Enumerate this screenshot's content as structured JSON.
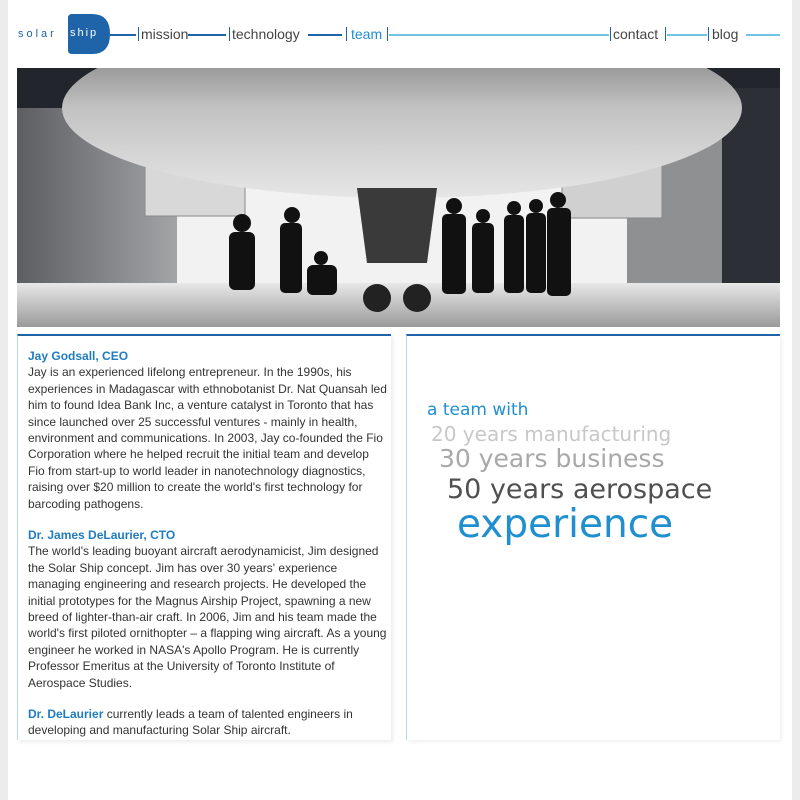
{
  "logo": {
    "solar": "solar",
    "ship": "ship"
  },
  "nav": {
    "items": [
      {
        "label": "mission",
        "active": false
      },
      {
        "label": "technology",
        "active": false
      },
      {
        "label": "team",
        "active": true
      },
      {
        "label": "contact",
        "active": false
      },
      {
        "label": "blog",
        "active": false
      }
    ]
  },
  "team": {
    "members": [
      {
        "name": "Jay Godsall, CEO",
        "bio": "Jay is an experienced lifelong entrepreneur. In the 1990s, his experiences in Madagascar with ethnobotanist Dr. Nat Quansah led him to found Idea Bank Inc, a venture catalyst in Toronto that has since launched over 25 successful ventures - mainly in health, environment and communications. In 2003, Jay co-founded the Fio Corporation where he helped recruit the initial team and develop Fio from start-up to world leader in nanotechnology diagnostics, raising over $20 million to create the world's first technology for barcoding pathogens."
      },
      {
        "name": "Dr. James DeLaurier, CTO",
        "bio": "The world's leading buoyant aircraft aerodynamicist, Jim designed the Solar Ship concept. Jim has over 30 years' experience managing engineering and research projects. He developed the initial prototypes for the Magnus Airship Project, spawning a new breed of lighter-than-air craft. In 2006, Jim and his team made the world's first piloted ornithopter – a flapping wing aircraft. As a young engineer he worked in NASA's Apollo Program.  He is currently Professor Emeritus at the University of Toronto Institute of Aerospace Studies."
      }
    ],
    "footnote": {
      "highlight": "Dr. DeLaurier",
      "text": " currently leads a team of talented engineers in developing and manufacturing Solar Ship aircraft."
    }
  },
  "tagline": {
    "line1": "a team with",
    "line2": "20 years manufacturing",
    "line3": "30 years business",
    "line4": "50 years aerospace",
    "line5": "experience"
  },
  "colors": {
    "brand": "#1f63a8",
    "accent": "#1f8fd0",
    "accent_light": "#74c2e6"
  }
}
